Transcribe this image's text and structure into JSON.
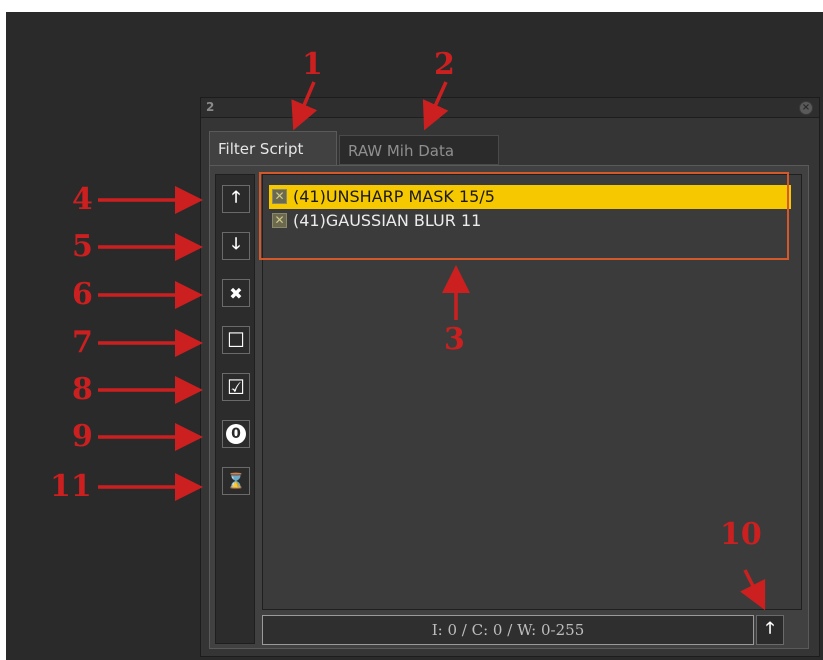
{
  "panel": {
    "number": "2",
    "close_glyph": "×"
  },
  "tabs": [
    {
      "label": "Filter Script",
      "active": true
    },
    {
      "label": "RAW Mih Data",
      "active": false
    }
  ],
  "toolbar": {
    "buttons": [
      {
        "icon": "arrow-up-icon",
        "glyph": "🡑"
      },
      {
        "icon": "arrow-down-icon",
        "glyph": "🡓"
      },
      {
        "icon": "delete-x-icon",
        "glyph": "✖"
      },
      {
        "icon": "uncheck-all-icon",
        "glyph": "☐"
      },
      {
        "icon": "check-all-icon",
        "glyph": "☑"
      },
      {
        "icon": "zero-icon",
        "glyph": "0"
      },
      {
        "icon": "hourglass-icon",
        "glyph": "⌛"
      }
    ]
  },
  "filter_list": [
    {
      "label": "(41)UNSHARP MASK 15/5",
      "checked": true,
      "selected": true
    },
    {
      "label": "(41)GAUSSIAN BLUR 11",
      "checked": true,
      "selected": false
    }
  ],
  "status_bar": {
    "text": "I: 0 / C: 0 / W: 0-255",
    "button_glyph": "🡑"
  },
  "annotations": [
    "1",
    "2",
    "3",
    "4",
    "5",
    "6",
    "7",
    "8",
    "9",
    "10",
    "11"
  ],
  "colors": {
    "selection": "#f5c800",
    "annotation": "#cc2020",
    "highlight_box": "#d4582a"
  }
}
